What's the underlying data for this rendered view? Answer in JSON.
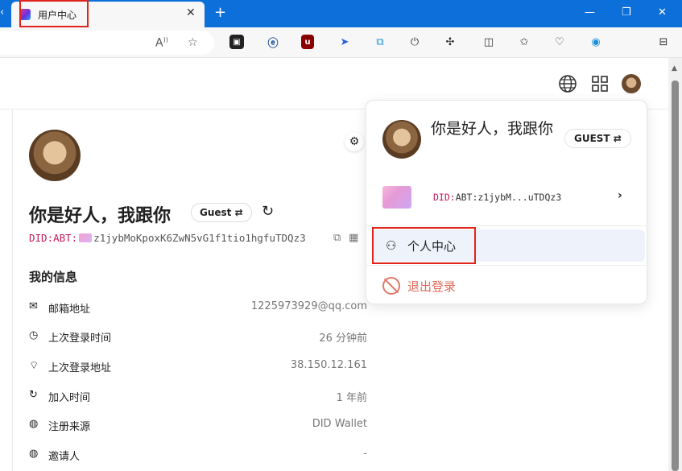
{
  "browser": {
    "tab_title": "用户中心",
    "new_tab_symbol": "+",
    "tab_close_symbol": "✕",
    "window_controls": [
      "—",
      "❐",
      "✕"
    ],
    "toolbar_icons": [
      "read-aloud-icon",
      "favorite-star-icon",
      "ext-tab-icon",
      "ext-e-icon",
      "ublock-icon",
      "ext-arrow-icon",
      "ext-translate-icon",
      "power-icon",
      "extensions-puzzle-icon",
      "split-screen-icon",
      "favorites-icon",
      "heart-pulse-icon",
      "edge-icon",
      "sidebar-icon"
    ]
  },
  "header": {
    "icons": [
      "globe-icon",
      "apps-grid-icon",
      "avatar"
    ]
  },
  "profile": {
    "name": "你是好人，我跟你",
    "role_badge": "Guest ⇄",
    "did_prefix": "DID:ABT:",
    "did_value": "z1jybMoKpoxK6ZwN5vG1f1tio1hgfuTDQz3",
    "section_title": "我的信息",
    "info_rows": [
      {
        "icon": "✉",
        "label": "邮箱地址",
        "value": "1225973929@qq.com"
      },
      {
        "icon": "◷",
        "label": "上次登录时间",
        "value": "26 分钟前"
      },
      {
        "icon": "⌔",
        "label": "上次登录地址",
        "value": "38.150.12.161"
      },
      {
        "icon": "↻",
        "label": "加入时间",
        "value": "1 年前"
      },
      {
        "icon": "◍",
        "label": "注册来源",
        "value": "DID Wallet"
      },
      {
        "icon": "◍",
        "label": "邀请人",
        "value": "-"
      }
    ]
  },
  "dropdown": {
    "name": "你是好人，我跟你",
    "role_badge": "GUEST ⇄",
    "did_prefix": "DID:",
    "did_short": "ABT:z1jybM...uTDQz3",
    "personal_center": "个人中心",
    "logout": "退出登录"
  },
  "colors": {
    "browser_accent": "#0d6fd9",
    "highlight_box": "#e0241c",
    "did_prefix": "#c2185b",
    "logout": "#e06a58",
    "menu_hover": "#eef3fb"
  }
}
